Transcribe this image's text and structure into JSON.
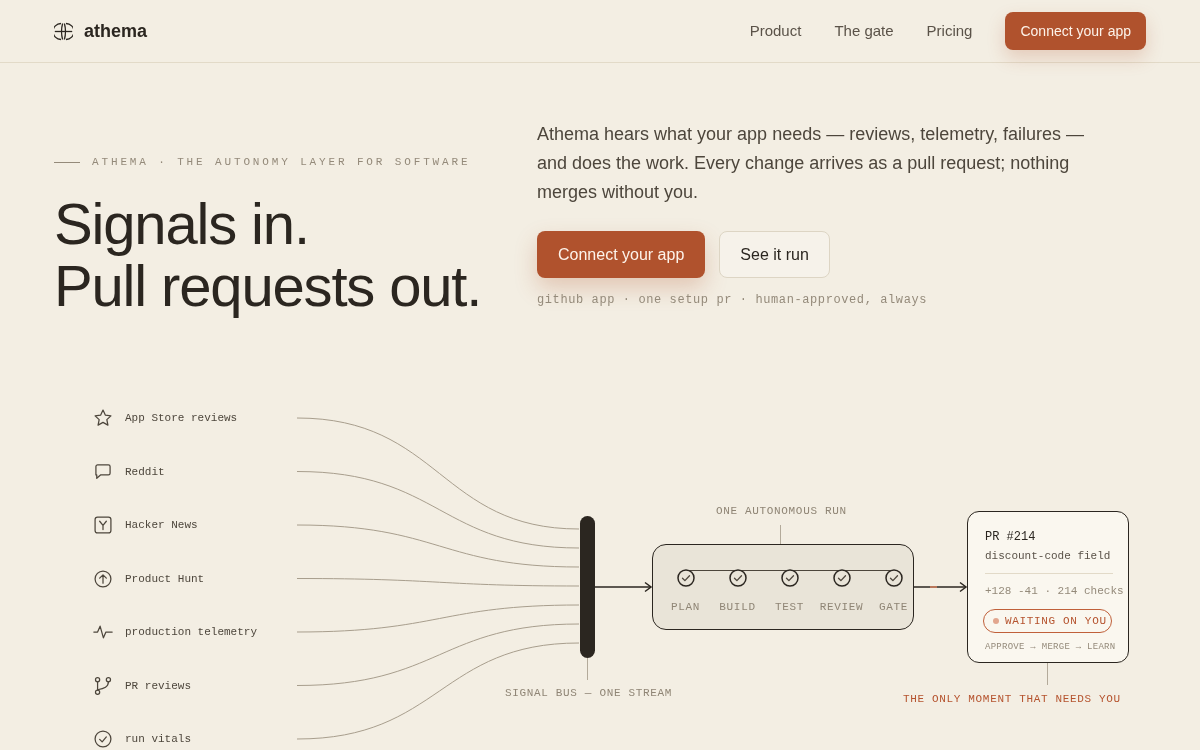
{
  "header": {
    "logo": "athema",
    "nav": [
      "Product",
      "The gate",
      "Pricing"
    ],
    "cta": "Connect your app"
  },
  "hero": {
    "eyebrow": "ATHEMA · THE AUTONOMY LAYER FOR SOFTWARE",
    "headline": [
      "Signals in.",
      "Pull requests out."
    ],
    "description": "Athema hears what your app needs — reviews, telemetry, failures — and does the work. Every change arrives as a pull request; nothing merges without you.",
    "buttons": [
      {
        "label": "Connect your app",
        "kind": "primary"
      },
      {
        "label": "See it run",
        "kind": "secondary"
      }
    ],
    "caption": "github app · one setup pr · human-approved, always"
  },
  "diagram": {
    "sources": [
      "App Store reviews",
      "Reddit",
      "Hacker News",
      "Product Hunt",
      "production telemetry",
      "PR reviews",
      "run vitals"
    ],
    "bus": {
      "label": "SIGNAL BUS — ONE STREAM"
    },
    "run": {
      "label": "ONE AUTONOMOUS RUN",
      "steps": [
        {
          "label": "PLAN",
          "done": true
        },
        {
          "label": "BUILD",
          "done": true
        },
        {
          "label": "TEST",
          "done": true
        },
        {
          "label": "REVIEW",
          "done": true
        },
        {
          "label": "GATE",
          "done": true
        }
      ]
    },
    "pull_request": {
      "title": "PR #214",
      "subtitle": "discount-code field",
      "stats": "+128 -41 · 214 checks",
      "status": "WAITING ON YOU",
      "next_steps": "APPROVE → MERGE → LEARN"
    },
    "note": "THE ONLY MOMENT THAT NEEDS YOU"
  }
}
